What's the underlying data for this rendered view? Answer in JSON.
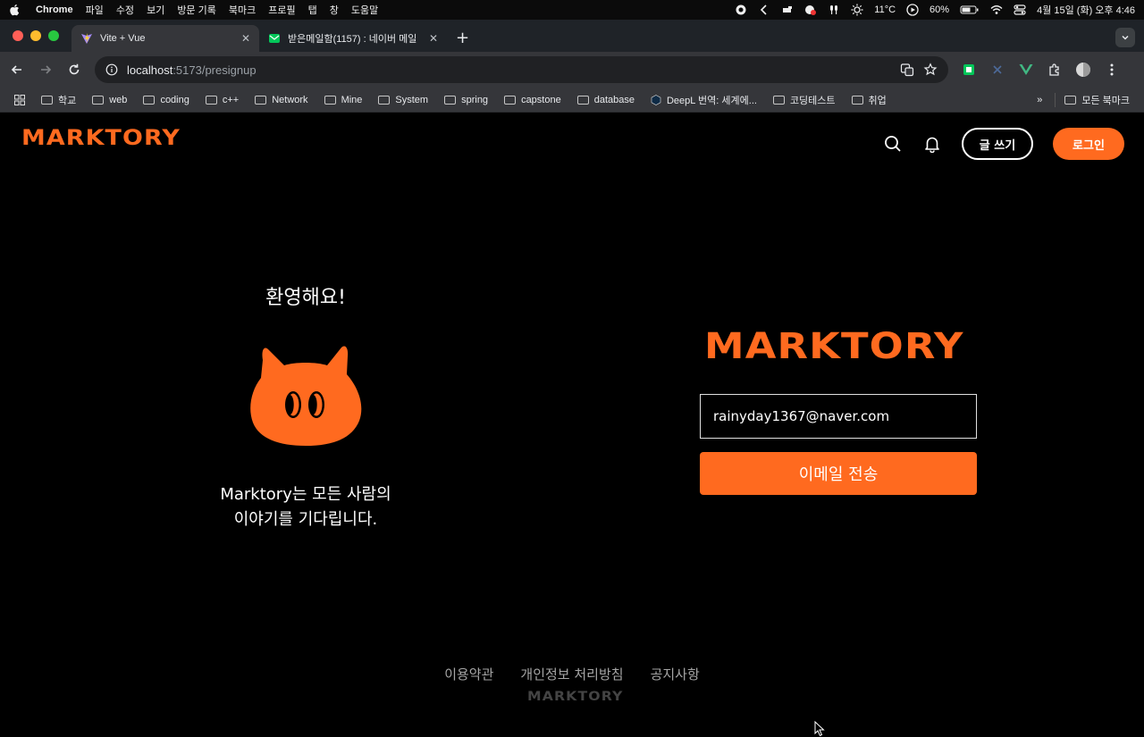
{
  "menubar": {
    "app": "Chrome",
    "items": [
      "파일",
      "수정",
      "보기",
      "방문 기록",
      "북마크",
      "프로필",
      "탭",
      "창",
      "도움말"
    ],
    "temperature": "11°C",
    "battery": "60%",
    "datetime": "4월 15일 (화) 오후 4:46"
  },
  "tabs": [
    {
      "label": "Vite + Vue",
      "active": true,
      "icon": "vite-icon"
    },
    {
      "label": "받은메일함(1157) : 네이버 메일",
      "active": false,
      "icon": "naver-mail-icon"
    }
  ],
  "toolbar": {
    "url_host": "localhost",
    "url_path": ":5173/presignup"
  },
  "bookmarks": {
    "items": [
      "학교",
      "web",
      "coding",
      "c++",
      "Network",
      "Mine",
      "System",
      "spring",
      "capstone",
      "database",
      "DeepL 번역: 세계에...",
      "코딩테스트",
      "취업"
    ],
    "more": "»",
    "all_bookmarks": "모든 북마크"
  },
  "header": {
    "logo": "MARKTORY",
    "write_label": "글 쓰기",
    "login_label": "로그인"
  },
  "left": {
    "welcome": "환영해요!",
    "tagline_line1": "Marktory는 모든 사람의",
    "tagline_line2": "이야기를 기다립니다."
  },
  "form": {
    "logo": "MARKTORY",
    "email_value": "rainyday1367@naver.com",
    "send_label": "이메일 전송"
  },
  "footer": {
    "links": [
      "이용약관",
      "개인정보 처리방침",
      "공지사항"
    ],
    "logo": "MARKTORY"
  },
  "colors": {
    "brand": "#ff6a1f",
    "background": "#000000"
  }
}
